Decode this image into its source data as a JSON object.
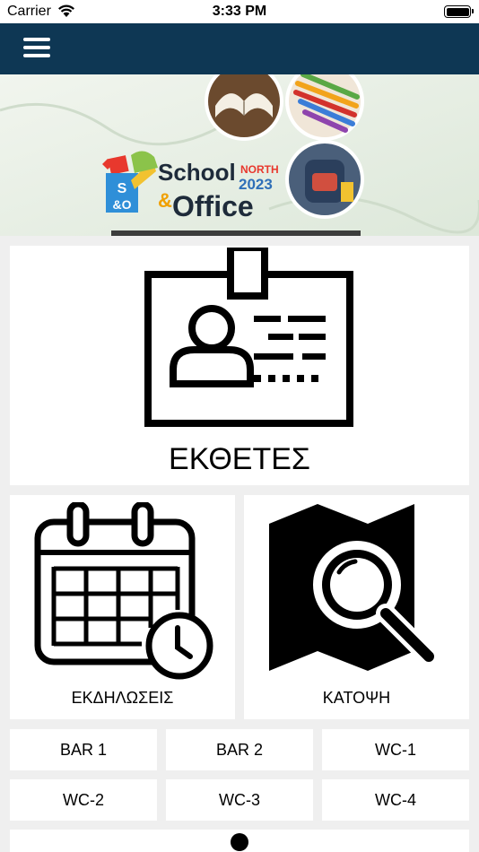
{
  "status_bar": {
    "carrier": "Carrier",
    "time": "3:33 PM"
  },
  "navbar": {
    "menu_icon": "hamburger-menu-icon",
    "color": "#0e3754"
  },
  "banner": {
    "title_line1": "School",
    "title_amp": "&",
    "title_line2": "Office",
    "north": "NORTH",
    "year": "2023",
    "logo_top": "S",
    "logo_bottom": "&O"
  },
  "tiles": {
    "exhibitors": {
      "label": "ΕΚΘΕΤΕΣ",
      "icon": "id-badge-icon"
    },
    "events": {
      "label": "ΕΚΔΗΛΩΣΕΙΣ",
      "icon": "calendar-clock-icon"
    },
    "floorplan": {
      "label": "ΚΑΤΟΨΗ",
      "icon": "map-search-icon"
    }
  },
  "buttons": [
    {
      "label": "BAR 1"
    },
    {
      "label": "BAR 2"
    },
    {
      "label": "WC-1"
    },
    {
      "label": "WC-2"
    },
    {
      "label": "WC-3"
    },
    {
      "label": "WC-4"
    }
  ],
  "bottom_tile": {
    "icon": "user-icon"
  }
}
